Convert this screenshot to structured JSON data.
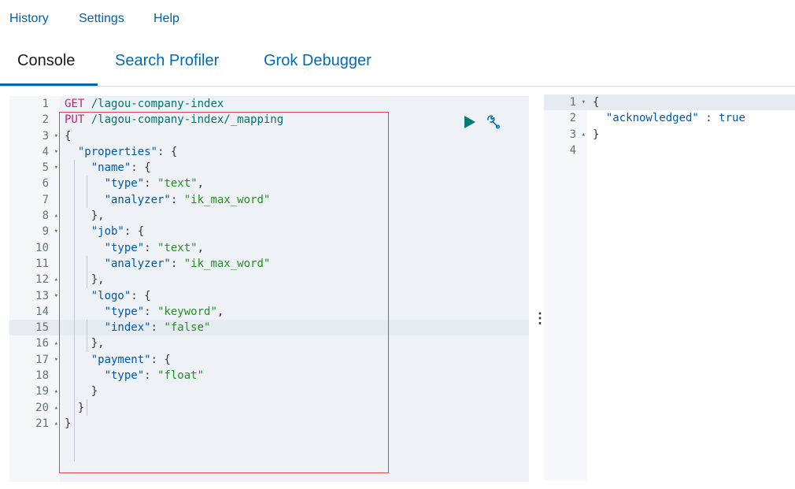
{
  "top_nav": {
    "history": "History",
    "settings": "Settings",
    "help": "Help"
  },
  "tabs": [
    {
      "label": "Console",
      "active": true
    },
    {
      "label": "Search Profiler",
      "active": false
    },
    {
      "label": "Grok Debugger",
      "active": false
    }
  ],
  "request_editor": {
    "highlighted_line": 15,
    "lines": [
      {
        "n": "1",
        "fold": ""
      },
      {
        "n": "2",
        "fold": ""
      },
      {
        "n": "3",
        "fold": "▾"
      },
      {
        "n": "4",
        "fold": "▾"
      },
      {
        "n": "5",
        "fold": "▾"
      },
      {
        "n": "6",
        "fold": ""
      },
      {
        "n": "7",
        "fold": ""
      },
      {
        "n": "8",
        "fold": "▴"
      },
      {
        "n": "9",
        "fold": "▾"
      },
      {
        "n": "10",
        "fold": ""
      },
      {
        "n": "11",
        "fold": ""
      },
      {
        "n": "12",
        "fold": "▴"
      },
      {
        "n": "13",
        "fold": "▾"
      },
      {
        "n": "14",
        "fold": ""
      },
      {
        "n": "15",
        "fold": ""
      },
      {
        "n": "16",
        "fold": "▴"
      },
      {
        "n": "17",
        "fold": "▾"
      },
      {
        "n": "18",
        "fold": ""
      },
      {
        "n": "19",
        "fold": "▴"
      },
      {
        "n": "20",
        "fold": "▴"
      },
      {
        "n": "21",
        "fold": "▴"
      }
    ],
    "code": {
      "l1_method": "GET",
      "l1_path": " /lagou-company-index",
      "l2_method": "PUT",
      "l2_path": " /lagou-company-index/_mapping",
      "l3": "{",
      "l4_key": "\"properties\"",
      "l5_key": "\"name\"",
      "l6_key": "\"type\"",
      "l6_val": "\"text\"",
      "l7_key": "\"analyzer\"",
      "l7_val": "\"ik_max_word\"",
      "l8": "},",
      "l9_key": "\"job\"",
      "l10_key": "\"type\"",
      "l10_val": "\"text\"",
      "l11_key": "\"analyzer\"",
      "l11_val": "\"ik_max_word\"",
      "l12": "},",
      "l13_key": "\"logo\"",
      "l14_key": "\"type\"",
      "l14_val": "\"keyword\"",
      "l15_key": "\"index\"",
      "l15_val": "\"false\"",
      "l16": "},",
      "l17_key": "\"payment\"",
      "l18_key": "\"type\"",
      "l18_val": "\"float\"",
      "l19": "}",
      "l20": "}",
      "l21": "}"
    }
  },
  "response_editor": {
    "lines": [
      {
        "n": "1",
        "fold": "▾"
      },
      {
        "n": "2",
        "fold": ""
      },
      {
        "n": "3",
        "fold": "▴"
      },
      {
        "n": "4",
        "fold": ""
      }
    ],
    "code": {
      "l1": "{",
      "l2_key": "\"acknowledged\"",
      "l2_sep": " : ",
      "l2_val": "true",
      "l3": "}"
    }
  },
  "colors": {
    "accent": "#006bb4",
    "run_button": "#017d73",
    "selection_border": "#e0464e",
    "gutter_bg": "#f5f7fa",
    "code_bg": "#eef1f5"
  },
  "icons": {
    "run": "play-icon",
    "settings": "wrench-icon",
    "resize": "vertical-dots-icon"
  }
}
